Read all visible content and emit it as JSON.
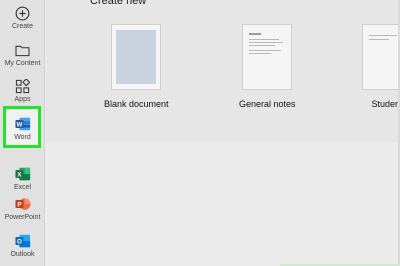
{
  "rail": {
    "items": [
      {
        "label": "Create",
        "icon": "plus-circle-icon"
      },
      {
        "label": "My Content",
        "icon": "folder-icon"
      },
      {
        "label": "Apps",
        "icon": "apps-grid-icon"
      },
      {
        "label": "Word",
        "icon": "word-icon"
      },
      {
        "label": "Excel",
        "icon": "excel-icon"
      },
      {
        "label": "PowerPoint",
        "icon": "powerpoint-icon"
      },
      {
        "label": "Outlook",
        "icon": "outlook-icon"
      }
    ],
    "selected": "Word"
  },
  "main": {
    "section_title": "Create new",
    "templates": [
      {
        "label": "Blank document"
      },
      {
        "label": "General notes"
      },
      {
        "label": "Student"
      }
    ]
  },
  "colors": {
    "highlight": "#22e22a",
    "word": "#2b579a",
    "excel": "#217346",
    "powerpoint": "#c43e1c",
    "outlook": "#0f6cbd"
  }
}
